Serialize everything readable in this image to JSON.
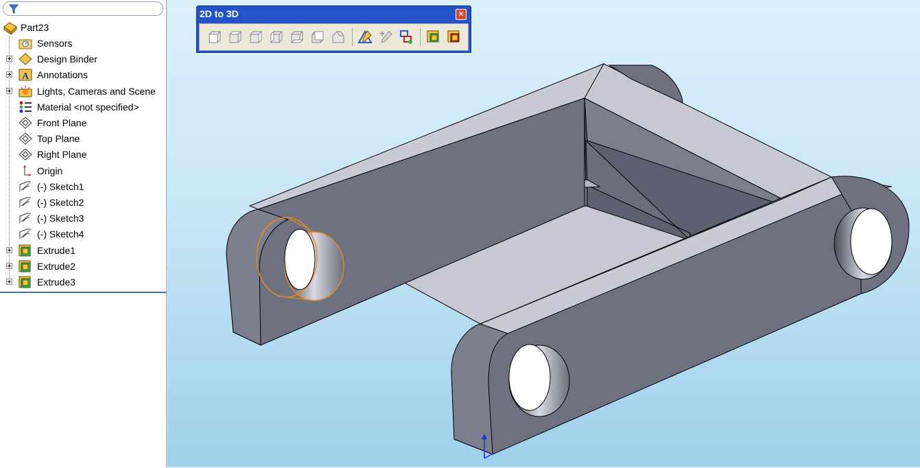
{
  "tree": {
    "root": "Part23",
    "items": [
      {
        "label": "Sensors",
        "icon": "sensors-icon",
        "expandable": false
      },
      {
        "label": "Design Binder",
        "icon": "design-binder-icon",
        "expandable": true
      },
      {
        "label": "Annotations",
        "icon": "annotations-icon",
        "expandable": true
      },
      {
        "label": "Lights, Cameras and Scene",
        "icon": "lights-icon",
        "expandable": true
      },
      {
        "label": "Material <not specified>",
        "icon": "material-icon",
        "expandable": false
      },
      {
        "label": "Front Plane",
        "icon": "plane-icon",
        "expandable": false
      },
      {
        "label": "Top Plane",
        "icon": "plane-icon",
        "expandable": false
      },
      {
        "label": "Right Plane",
        "icon": "plane-icon",
        "expandable": false
      },
      {
        "label": "Origin",
        "icon": "origin-icon",
        "expandable": false
      },
      {
        "label": "(-) Sketch1",
        "icon": "sketch-icon",
        "expandable": false
      },
      {
        "label": "(-) Sketch2",
        "icon": "sketch-icon",
        "expandable": false
      },
      {
        "label": "(-) Sketch3",
        "icon": "sketch-icon",
        "expandable": false
      },
      {
        "label": "(-) Sketch4",
        "icon": "sketch-icon",
        "expandable": false
      },
      {
        "label": "Extrude1",
        "icon": "extrude-icon",
        "expandable": true
      },
      {
        "label": "Extrude2",
        "icon": "extrude-icon",
        "expandable": true
      },
      {
        "label": "Extrude3",
        "icon": "extrude-icon",
        "expandable": true
      }
    ]
  },
  "toolbar": {
    "title": "2D to 3D",
    "buttons": [
      "front-view-icon",
      "top-view-icon",
      "right-view-icon",
      "left-view-icon",
      "bottom-view-icon",
      "back-view-icon",
      "auxiliary-view-icon",
      "new-sketch-icon",
      "add-to-sketch-icon",
      "repair-sketch-icon",
      "extrude-icon",
      "cut-icon"
    ]
  },
  "colors": {
    "highlight": "#e8891e",
    "model_face": "#6e7180",
    "model_top": "#c9cad6",
    "titlebar": "#2452c8"
  }
}
